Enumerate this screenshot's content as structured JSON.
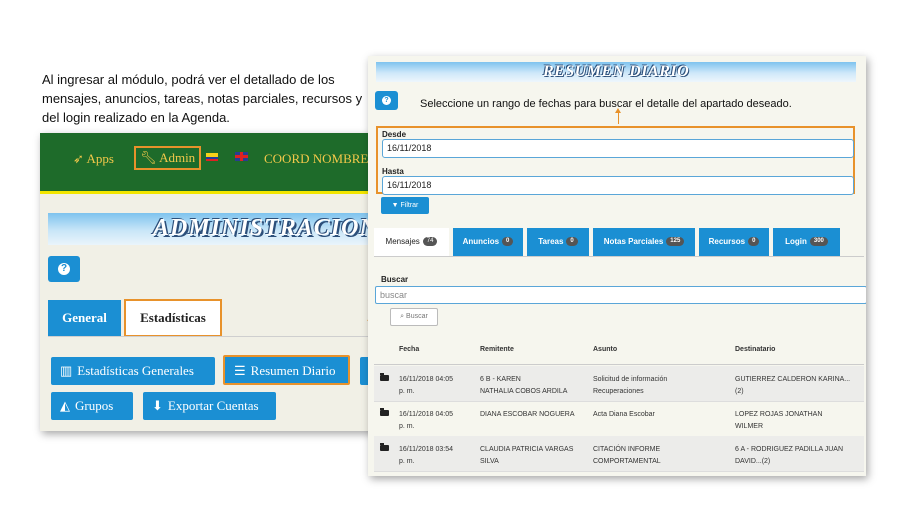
{
  "caption": "Al ingresar al módulo, podrá ver el detallado de los mensajes, anuncios, tareas, notas parciales, recursos y del login realizado en la Agenda.",
  "left": {
    "topbar": {
      "apps": "Apps",
      "admin": "Admin",
      "coord": "COORD NOMBRES"
    },
    "banner": "ADMINISTRACION",
    "tabs": {
      "general": "General",
      "estadisticas": "Estadísticas"
    },
    "buttons": {
      "estadisticas_generales": "Estadísticas Generales",
      "resumen_diario": "Resumen Diario",
      "grupos": "Grupos",
      "exportar": "Exportar Cuentas"
    }
  },
  "right": {
    "banner": "RESUMEN DIARIO",
    "instruction": "Seleccione un rango de fechas para buscar el detalle del apartado deseado.",
    "desde_label": "Desde",
    "desde_value": "16/11/2018",
    "hasta_label": "Hasta",
    "hasta_value": "16/11/2018",
    "filtrar": "Filtrar",
    "tabs": [
      {
        "label": "Mensajes",
        "count": "74"
      },
      {
        "label": "Anuncios",
        "count": "0"
      },
      {
        "label": "Tareas",
        "count": "0"
      },
      {
        "label": "Notas Parciales",
        "count": "125"
      },
      {
        "label": "Recursos",
        "count": "0"
      },
      {
        "label": "Login",
        "count": "300"
      }
    ],
    "buscar_label": "Buscar",
    "buscar_placeholder": "buscar",
    "buscar_button": "Buscar",
    "columns": [
      "Fecha",
      "Remitente",
      "Asunto",
      "Destinatario"
    ],
    "rows": [
      {
        "fecha1": "16/11/2018 04:05",
        "fecha2": "p. m.",
        "rem1": "6 B - KAREN",
        "rem2": "NATHALIA COBOS ARDILA",
        "asu1": "Solicitud de información",
        "asu2": "Recuperaciones",
        "des1": "GUTIERREZ CALDERON KARINA...",
        "des2": "(2)"
      },
      {
        "fecha1": "16/11/2018 04:05",
        "fecha2": "p. m.",
        "rem1": "DIANA ESCOBAR NOGUERA",
        "rem2": "",
        "asu1": "Acta Diana Escobar",
        "asu2": "",
        "des1": "LOPEZ ROJAS JONATHAN",
        "des2": "WILMER"
      },
      {
        "fecha1": "16/11/2018 03:54",
        "fecha2": "p. m.",
        "rem1": "CLAUDIA PATRICIA VARGAS",
        "rem2": "SILVA",
        "asu1": "CITACIÓN INFORME",
        "asu2": "COMPORTAMENTAL",
        "des1": "6 A - RODRIGUEZ PADILLA JUAN",
        "des2": "DAVID...(2)"
      }
    ]
  },
  "icons": {
    "apps": "rocket-icon",
    "admin": "wrench-icon",
    "help": "question-circle-icon",
    "bar_chart": "bar-chart-icon",
    "list": "list-icon",
    "area_chart": "area-chart-icon",
    "download": "download-icon",
    "filter": "filter-icon",
    "search": "search-icon",
    "folder": "folder-open-icon"
  },
  "colors": {
    "primary": "#1b8fd3",
    "highlight": "#e8922b",
    "topbar": "#1e6b2a",
    "gold": "#f2c84a"
  }
}
